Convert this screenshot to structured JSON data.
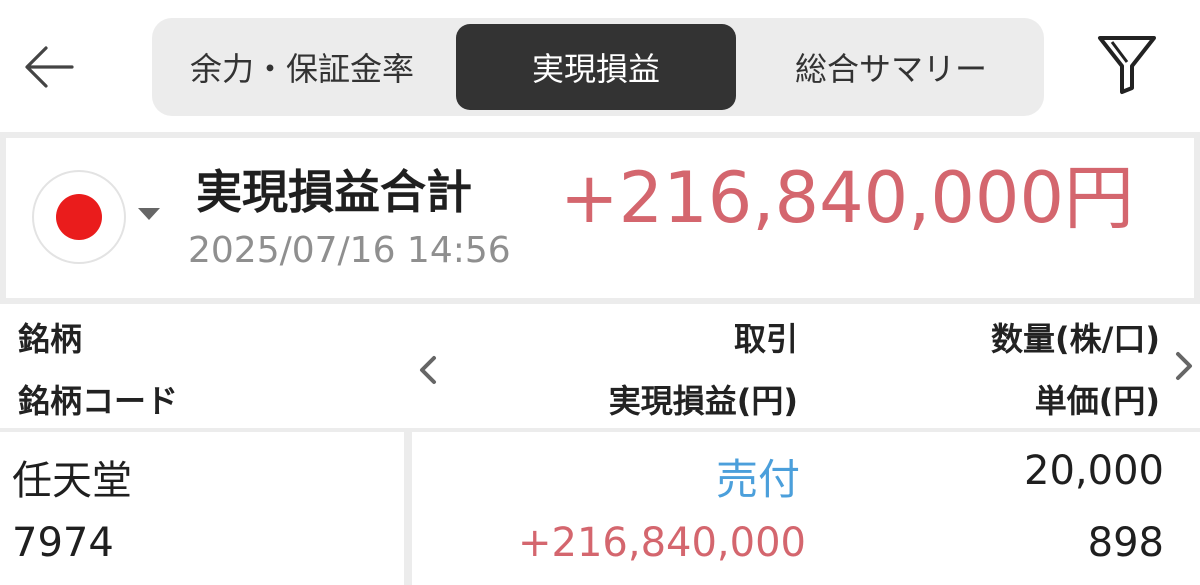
{
  "tabs": [
    {
      "label": "余力・保証金率",
      "active": false
    },
    {
      "label": "実現損益",
      "active": true
    },
    {
      "label": "総合サマリー",
      "active": false
    }
  ],
  "icons": {
    "back": "back-arrow-icon",
    "filter": "filter-icon",
    "flag": "japan-flag-icon",
    "nav_prev": "chevron-left-icon",
    "nav_next": "chevron-right-icon"
  },
  "summary": {
    "title": "実現損益合計",
    "amount": "+216,840,000円",
    "timestamp": "2025/07/16 14:56"
  },
  "table": {
    "headers": {
      "col1_line1": "銘柄",
      "col1_line2": "銘柄コード",
      "col2_line1": "取引",
      "col2_line2": "実現損益(円)",
      "col3_line1": "数量(株/口)",
      "col3_line2": "単価(円)"
    },
    "rows": [
      {
        "name": "任天堂",
        "code": "7974",
        "trade": "売付",
        "realized_pl": "+216,840,000",
        "quantity": "20,000",
        "unit_price": "898"
      }
    ]
  },
  "colors": {
    "positive": "#d4666e",
    "sell": "#4b9fdb",
    "active_tab": "#333333",
    "flag_red": "#ea1c1c"
  }
}
